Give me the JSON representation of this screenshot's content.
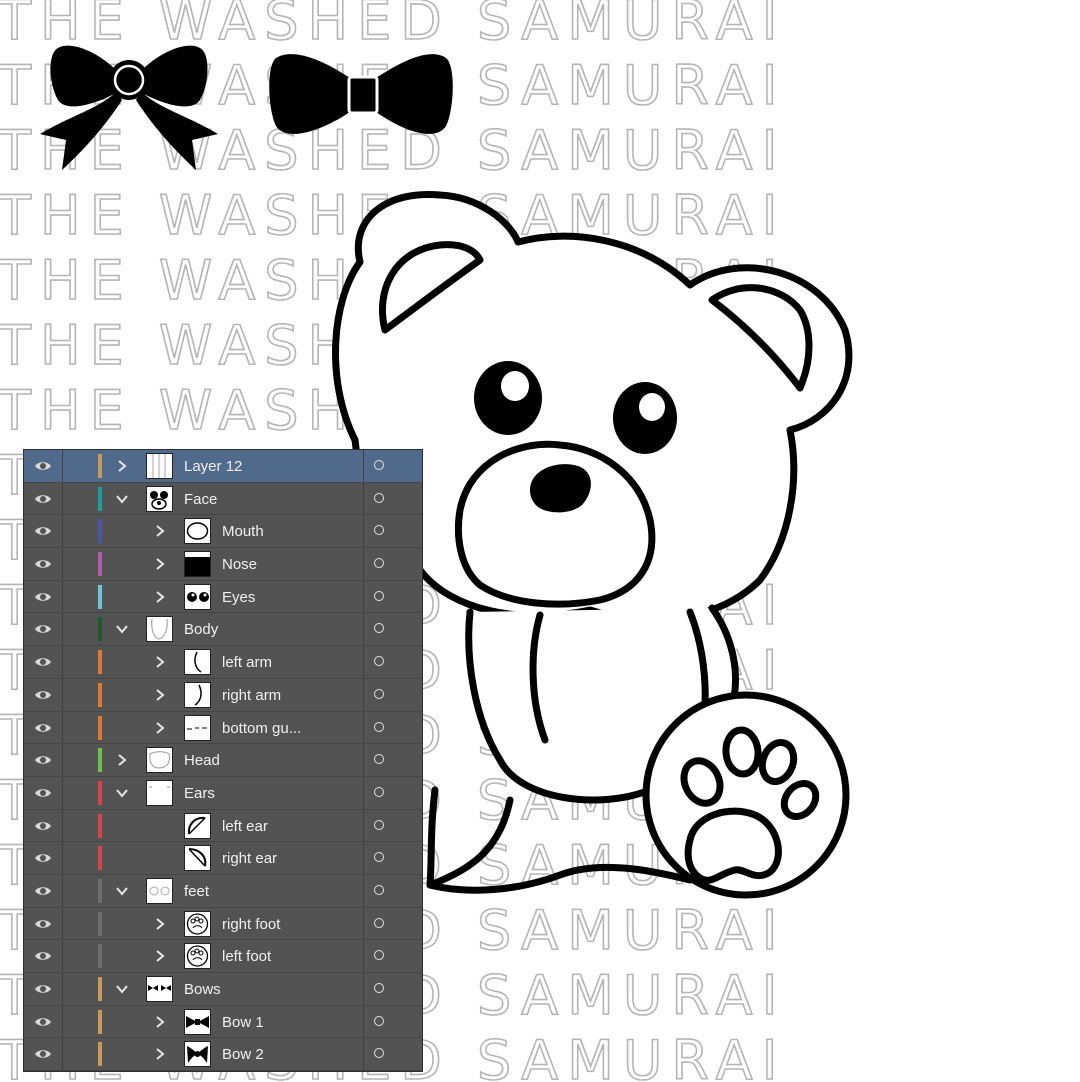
{
  "watermark": {
    "text": "THE WASHED SAMURAI",
    "rows": 17
  },
  "artwork": {
    "icons": [
      "bow-1-icon",
      "bow-2-icon",
      "teddy-bear-outline"
    ]
  },
  "layers_panel": {
    "rows": [
      {
        "name": "Layer 12",
        "depth": 0,
        "expanded": false,
        "has_toggle": true,
        "selected": true,
        "color": "#c79a5a",
        "thumb": "layer12"
      },
      {
        "name": "Face",
        "depth": 0,
        "expanded": true,
        "has_toggle": true,
        "selected": false,
        "color": "#18a09a",
        "thumb": "face"
      },
      {
        "name": "Mouth",
        "depth": 1,
        "expanded": false,
        "has_toggle": true,
        "selected": false,
        "color": "#4b56a8",
        "thumb": "mouth"
      },
      {
        "name": "Nose",
        "depth": 1,
        "expanded": false,
        "has_toggle": true,
        "selected": false,
        "color": "#b05fa8",
        "thumb": "nose"
      },
      {
        "name": "Eyes",
        "depth": 1,
        "expanded": false,
        "has_toggle": true,
        "selected": false,
        "color": "#6cc6d8",
        "thumb": "eyes"
      },
      {
        "name": "Body",
        "depth": 0,
        "expanded": true,
        "has_toggle": true,
        "selected": false,
        "color": "#1f5a2f",
        "thumb": "body"
      },
      {
        "name": "left arm",
        "depth": 1,
        "expanded": false,
        "has_toggle": true,
        "selected": false,
        "color": "#e07a30",
        "thumb": "leftarm"
      },
      {
        "name": "right arm",
        "depth": 1,
        "expanded": false,
        "has_toggle": true,
        "selected": false,
        "color": "#e07a30",
        "thumb": "rightarm"
      },
      {
        "name": "bottom gu...",
        "depth": 1,
        "expanded": false,
        "has_toggle": true,
        "selected": false,
        "color": "#e07a30",
        "thumb": "bottom"
      },
      {
        "name": "Head",
        "depth": 0,
        "expanded": false,
        "has_toggle": true,
        "selected": false,
        "color": "#6fc04a",
        "thumb": "head"
      },
      {
        "name": "Ears",
        "depth": 0,
        "expanded": true,
        "has_toggle": true,
        "selected": false,
        "color": "#d8434a",
        "thumb": "ears"
      },
      {
        "name": "left ear",
        "depth": 1,
        "expanded": false,
        "has_toggle": false,
        "selected": false,
        "color": "#d8434a",
        "thumb": "leftear"
      },
      {
        "name": "right ear",
        "depth": 1,
        "expanded": false,
        "has_toggle": false,
        "selected": false,
        "color": "#d8434a",
        "thumb": "rightear"
      },
      {
        "name": "feet",
        "depth": 0,
        "expanded": true,
        "has_toggle": true,
        "selected": false,
        "color": "#6e6e6e",
        "thumb": "feet"
      },
      {
        "name": "right foot",
        "depth": 1,
        "expanded": false,
        "has_toggle": true,
        "selected": false,
        "color": "#6e6e6e",
        "thumb": "foot"
      },
      {
        "name": "left foot",
        "depth": 1,
        "expanded": false,
        "has_toggle": true,
        "selected": false,
        "color": "#6e6e6e",
        "thumb": "foot"
      },
      {
        "name": "Bows",
        "depth": 0,
        "expanded": true,
        "has_toggle": true,
        "selected": false,
        "color": "#c79a5a",
        "thumb": "bows"
      },
      {
        "name": "Bow 1",
        "depth": 1,
        "expanded": false,
        "has_toggle": true,
        "selected": false,
        "color": "#c79a5a",
        "thumb": "bow1"
      },
      {
        "name": "Bow 2",
        "depth": 1,
        "expanded": false,
        "has_toggle": true,
        "selected": false,
        "color": "#c79a5a",
        "thumb": "bow2"
      }
    ]
  }
}
